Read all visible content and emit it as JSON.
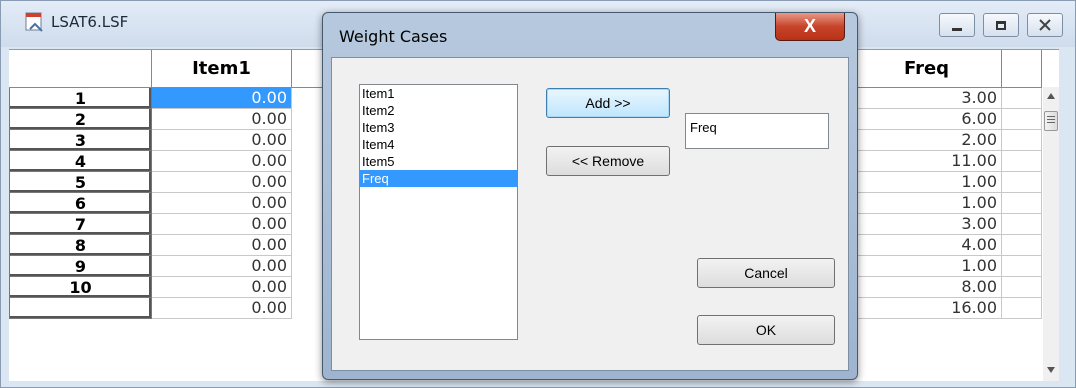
{
  "window": {
    "title": "LSAT6.LSF",
    "icon": "document-icon"
  },
  "grid": {
    "columns": [
      "Item1",
      "Freq"
    ],
    "rows": [
      {
        "label": "1",
        "item1": "0.00",
        "freq": "3.00"
      },
      {
        "label": "2",
        "item1": "0.00",
        "freq": "6.00"
      },
      {
        "label": "3",
        "item1": "0.00",
        "freq": "2.00"
      },
      {
        "label": "4",
        "item1": "0.00",
        "freq": "11.00"
      },
      {
        "label": "5",
        "item1": "0.00",
        "freq": "1.00"
      },
      {
        "label": "6",
        "item1": "0.00",
        "freq": "1.00"
      },
      {
        "label": "7",
        "item1": "0.00",
        "freq": "3.00"
      },
      {
        "label": "8",
        "item1": "0.00",
        "freq": "4.00"
      },
      {
        "label": "9",
        "item1": "0.00",
        "freq": "1.00"
      },
      {
        "label": "10",
        "item1": "0.00",
        "freq": "8.00"
      },
      {
        "label": "",
        "item1": "0.00",
        "freq": "16.00"
      }
    ],
    "selection_color": "#3399ff"
  },
  "dialog": {
    "title": "Weight Cases",
    "close_label": "X",
    "variables": [
      "Item1",
      "Item2",
      "Item3",
      "Item4",
      "Item5",
      "Freq"
    ],
    "selected_variable": "Freq",
    "add_label": "Add >>",
    "remove_label": "<< Remove",
    "weight_field_value": "Freq",
    "cancel_label": "Cancel",
    "ok_label": "OK"
  }
}
